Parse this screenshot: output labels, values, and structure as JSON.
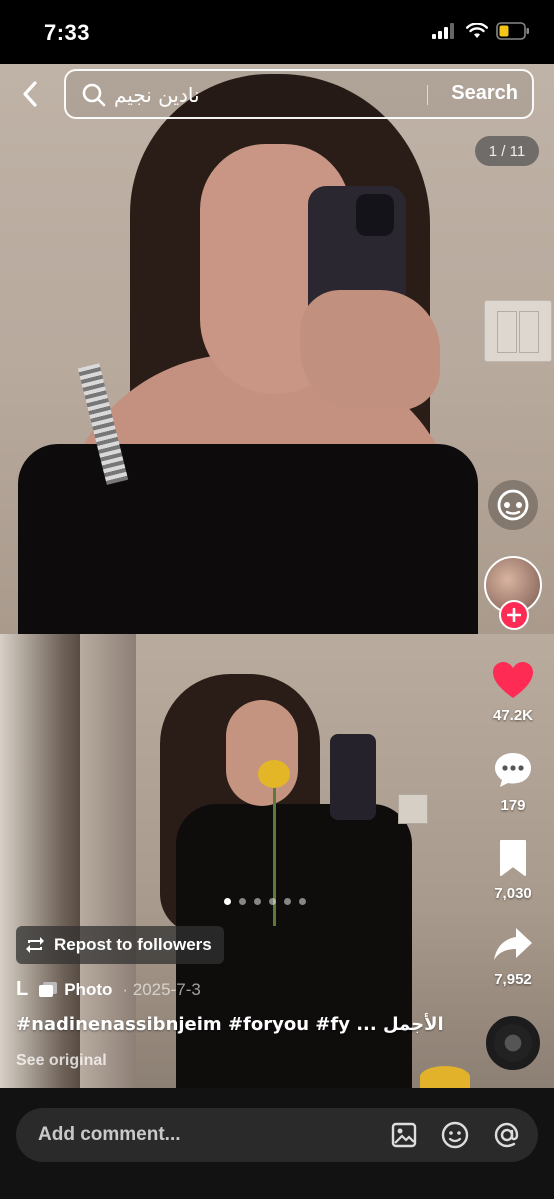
{
  "status_bar": {
    "time": "7:33"
  },
  "header": {
    "search_query": "نادين نجيم",
    "search_button": "Search"
  },
  "page_counter": "1 / 11",
  "actions": {
    "likes": "47.2K",
    "comments": "179",
    "saves": "7,030",
    "shares": "7,952"
  },
  "colors": {
    "like": "#fe2c55",
    "follow": "#fe2c55",
    "background": "#000000",
    "comment_bar": "#121212"
  },
  "carousel": {
    "total_dots": 6,
    "active_index": 0
  },
  "post": {
    "repost_label": "Repost to followers",
    "author": "L",
    "type_label": "Photo",
    "date": "· 2025-7-3",
    "caption": "#nadinenassibnjeim #foryou #fy ... الأجمل",
    "see_original": "See original"
  },
  "comment_bar": {
    "placeholder": "Add comment..."
  },
  "icons": [
    "back-icon",
    "search-icon",
    "sticker-icon",
    "heart-icon",
    "comment-icon",
    "bookmark-icon",
    "share-icon",
    "repost-icon",
    "photo-icon",
    "image-icon",
    "emoji-icon",
    "mention-icon"
  ]
}
